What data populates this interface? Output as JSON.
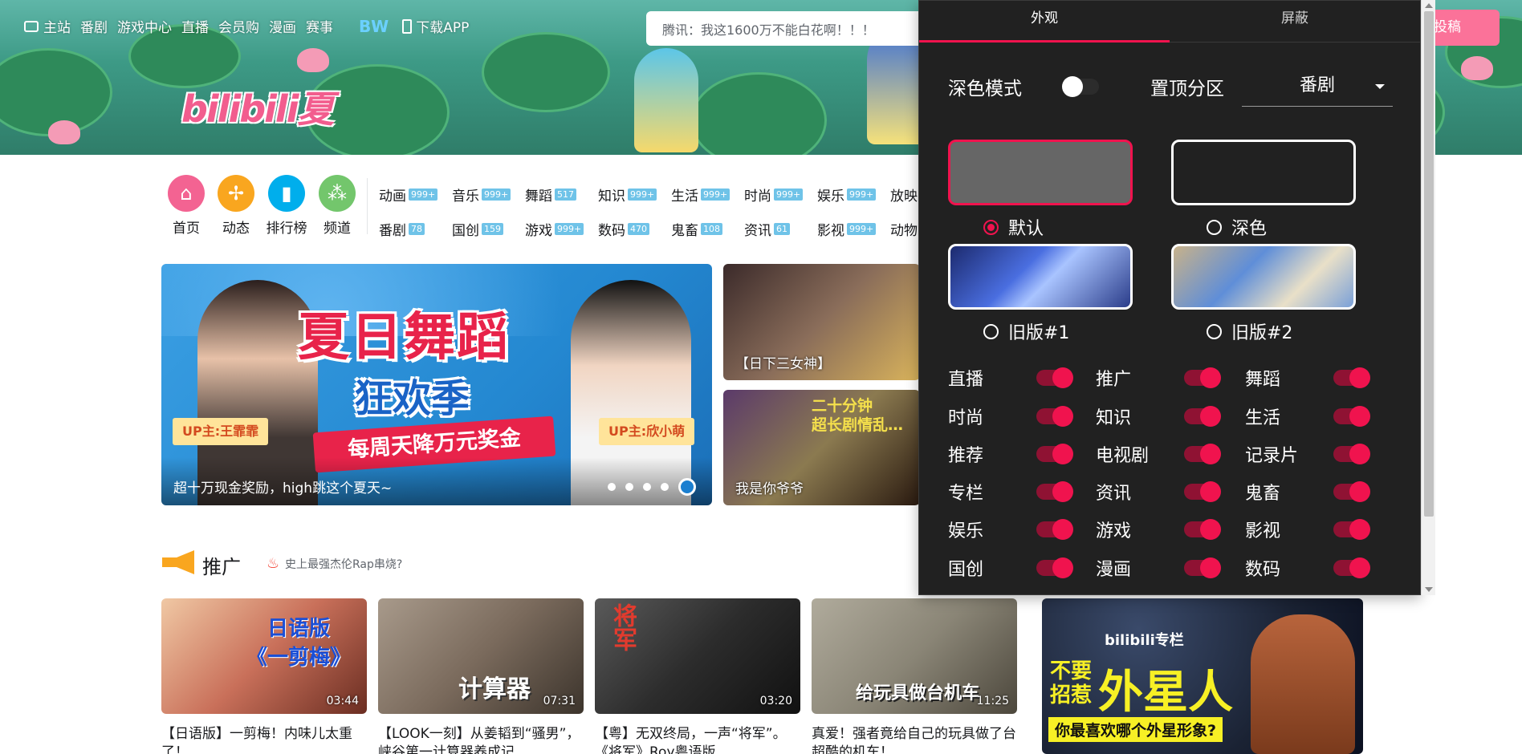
{
  "topnav": {
    "items": [
      {
        "label": "主站",
        "icon": "tv-icon"
      },
      {
        "label": "番剧"
      },
      {
        "label": "游戏中心"
      },
      {
        "label": "直播"
      },
      {
        "label": "会员购"
      },
      {
        "label": "漫画"
      },
      {
        "label": "赛事"
      }
    ],
    "bw": "BW",
    "download": "下载APP"
  },
  "search": {
    "placeholder": "腾讯：我这1600万不能白花啊！！！"
  },
  "post_button": "投稿",
  "logo": "bilibili夏",
  "channels": [
    {
      "label": "首页",
      "color": "#f36392",
      "icon": "home-icon"
    },
    {
      "label": "动态",
      "color": "#f9a61f",
      "icon": "pinwheel-icon"
    },
    {
      "label": "排行榜",
      "color": "#00aeec",
      "icon": "bar-chart-icon"
    },
    {
      "label": "频道",
      "color": "#73c66c",
      "icon": "channel-icon"
    }
  ],
  "partitions_row1": [
    {
      "name": "动画",
      "count": "999+"
    },
    {
      "name": "音乐",
      "count": "999+"
    },
    {
      "name": "舞蹈",
      "count": "517"
    },
    {
      "name": "知识",
      "count": "999+"
    },
    {
      "name": "生活",
      "count": "999+"
    },
    {
      "name": "时尚",
      "count": "999+"
    },
    {
      "name": "娱乐",
      "count": "999+"
    },
    {
      "name": "放映"
    }
  ],
  "partitions_row2": [
    {
      "name": "番剧",
      "count": "78"
    },
    {
      "name": "国创",
      "count": "159"
    },
    {
      "name": "游戏",
      "count": "999+"
    },
    {
      "name": "数码",
      "count": "470"
    },
    {
      "name": "鬼畜",
      "count": "108"
    },
    {
      "name": "资讯",
      "count": "61"
    },
    {
      "name": "影视",
      "count": "999+"
    },
    {
      "name": "动物"
    }
  ],
  "carousel": {
    "title_line1": "夏日舞蹈",
    "title_line2": "狂欢季",
    "ribbon": "每周天降万元奖金",
    "tag_left": "UP主:王霏霏",
    "tag_right": "UP主:欣小萌",
    "caption": "超十万现金奖励，high跳这个夏天~"
  },
  "side_thumbs": [
    {
      "caption": "【日下三女神】"
    },
    {
      "caption": "我是你爷爷",
      "overlay": "二十分钟\n超长剧情乱…"
    }
  ],
  "section": {
    "title": "推广",
    "hot": "史上最强杰伦Rap串烧?"
  },
  "videos": [
    {
      "overlay": "日语版\n《一剪梅》",
      "duration": "03:44",
      "title": "【日语版】一剪梅！内味儿太重了！",
      "bg": "#c9705a"
    },
    {
      "overlay": "计算器",
      "duration": "07:31",
      "title": "【LOOK一刻】从姜韬到“骚男”，峡谷第一计算器养成记",
      "bg": "#7a6a5c"
    },
    {
      "overlay": "将军",
      "duration": "03:20",
      "title": "【粤】无双终局，一声“将军”。《将军》Roy粤语版",
      "bg": "#2c2c2c"
    },
    {
      "overlay": "给玩具做台机车",
      "duration": "11:25",
      "title": "真爱！强者竟给自己的玩具做了台超酷的机车！",
      "bg": "#8a8576"
    }
  ],
  "big_ad": {
    "brand": "bilibili专栏",
    "line1": "不要招惹",
    "line2": "外星人",
    "line3": "你最喜欢哪个外星形象?"
  },
  "panel": {
    "tabs": [
      "外观",
      "屏蔽"
    ],
    "dark_mode_label": "深色模式",
    "dark_mode_on": false,
    "pin_label": "置顶分区",
    "pin_value": "番剧",
    "themes": [
      {
        "label": "默认",
        "selected": true
      },
      {
        "label": "深色",
        "selected": false
      },
      {
        "label": "旧版#1",
        "selected": false
      },
      {
        "label": "旧版#2",
        "selected": false
      }
    ],
    "toggles": [
      {
        "label": "直播",
        "on": true
      },
      {
        "label": "推广",
        "on": true
      },
      {
        "label": "舞蹈",
        "on": true
      },
      {
        "label": "时尚",
        "on": true
      },
      {
        "label": "知识",
        "on": true
      },
      {
        "label": "生活",
        "on": true
      },
      {
        "label": "推荐",
        "on": true
      },
      {
        "label": "电视剧",
        "on": true
      },
      {
        "label": "记录片",
        "on": true
      },
      {
        "label": "专栏",
        "on": true
      },
      {
        "label": "资讯",
        "on": true
      },
      {
        "label": "鬼畜",
        "on": true
      },
      {
        "label": "娱乐",
        "on": true
      },
      {
        "label": "游戏",
        "on": true
      },
      {
        "label": "影视",
        "on": true
      },
      {
        "label": "国创",
        "on": true
      },
      {
        "label": "漫画",
        "on": true
      },
      {
        "label": "数码",
        "on": true
      }
    ]
  },
  "colors": {
    "accent": "#f0134e",
    "pink": "#fb7299",
    "panel_bg": "#212121",
    "count_badge": "#6fc3e8"
  }
}
